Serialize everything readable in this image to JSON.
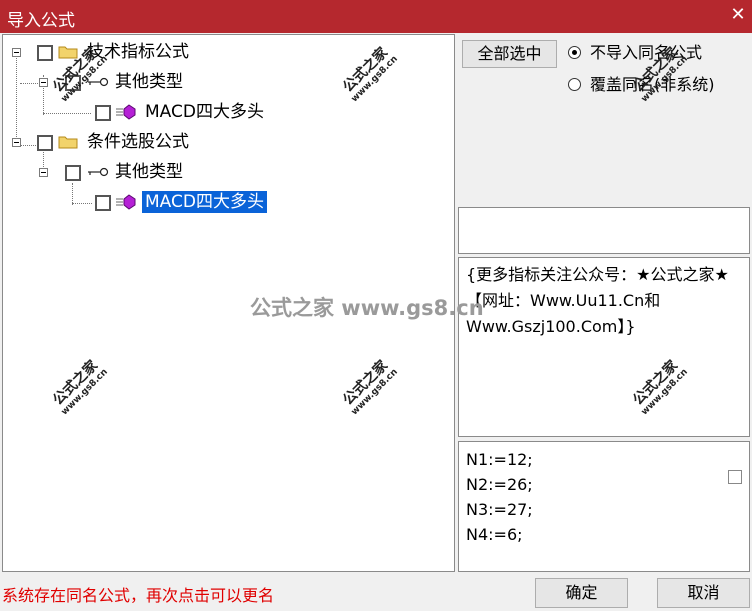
{
  "window": {
    "title": "导入公式",
    "close_glyph": "✕"
  },
  "tree": {
    "items": [
      {
        "label": "技术指标公式"
      },
      {
        "label": "其他类型"
      },
      {
        "label": "MACD四大多头"
      },
      {
        "label": "条件选股公式"
      },
      {
        "label": "其他类型"
      },
      {
        "label": "MACD四大多头",
        "selected": true
      }
    ]
  },
  "buttons": {
    "select_all": "全部选中",
    "ok": "确定",
    "cancel": "取消"
  },
  "options": [
    {
      "label": "不导入同名公式",
      "checked": true
    },
    {
      "label": "覆盖同名(非系统)",
      "checked": false
    }
  ],
  "info_text": "{更多指标关注公众号：★公式之家★ 【网址：Www.Uu11.Cn和Www.Gszj100.Com】}",
  "params": [
    "N1:=12;",
    "N2:=26;",
    "N3:=27;",
    "N4:=6;"
  ],
  "status": "系统存在同名公式，再次点击可以更名",
  "watermark": {
    "brand": "公式之家",
    "url": "www.gs8.cn",
    "center": "公式之家 www.gs8.cn"
  },
  "colors": {
    "titlebar": "#b5282e",
    "selection": "#0a63d8",
    "status_text": "#e00000"
  },
  "icons": [
    "folder-icon",
    "key-icon",
    "formula-icon",
    "checkbox-icon",
    "close-icon"
  ]
}
